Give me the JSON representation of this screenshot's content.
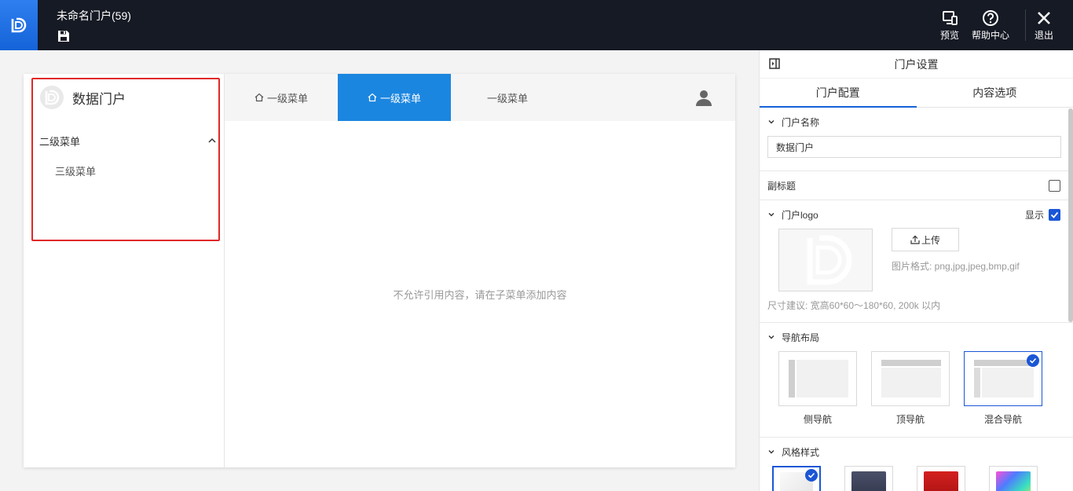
{
  "header": {
    "title": "未命名门户(59)",
    "actions": {
      "preview": "预览",
      "help": "帮助中心",
      "exit": "退出"
    }
  },
  "portal": {
    "name": "数据门户",
    "sidebar": {
      "level2": "二级菜单",
      "level3": "三级菜单"
    },
    "nav": [
      {
        "label": "一级菜单",
        "icon": "home-icon",
        "active": false
      },
      {
        "label": "一级菜单",
        "icon": "home-icon",
        "active": true
      },
      {
        "label": "一级菜单",
        "icon": null,
        "active": false
      }
    ],
    "empty_message": "不允许引用内容，请在子菜单添加内容"
  },
  "panel": {
    "title": "门户设置",
    "tabs": [
      "门户配置",
      "内容选项"
    ],
    "name_section": {
      "label": "门户名称",
      "value": "数据门户"
    },
    "subtitle_section": {
      "label": "副标题",
      "checked": false
    },
    "logo_section": {
      "label": "门户logo",
      "show_label": "显示",
      "show_checked": true,
      "upload_label": "上传",
      "format_hint": "图片格式: png,jpg,jpeg,bmp,gif",
      "size_hint": "尺寸建议: 宽高60*60～180*60, 200k 以内"
    },
    "nav_layout": {
      "label": "导航布局",
      "options": [
        "侧导航",
        "顶导航",
        "混合导航"
      ],
      "selected": "混合导航"
    },
    "style": {
      "label": "风格样式",
      "swatches": [
        "#eeeeee",
        "#3a3f55",
        "#c0181a",
        "rainbow"
      ],
      "selected_index": 0
    }
  },
  "colors": {
    "topbar": "#161a24",
    "accent": "#1b86e0",
    "brand_blue": "#1463d8",
    "highlight_box": "#e02828"
  }
}
